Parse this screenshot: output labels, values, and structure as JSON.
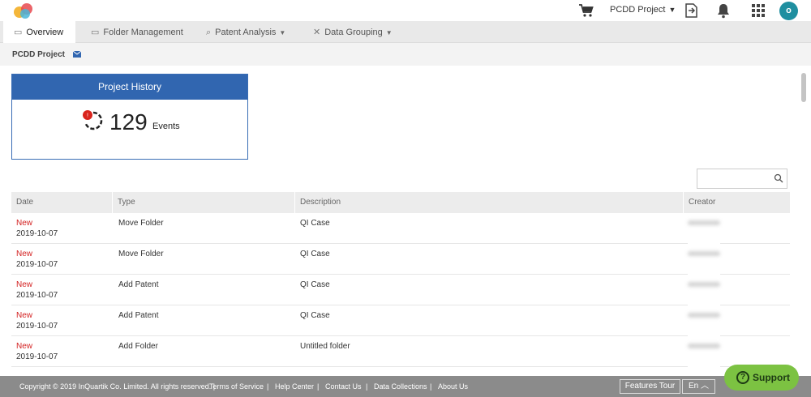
{
  "header": {
    "project_selector": "PCDD Project",
    "avatar_initial": "o"
  },
  "tabs": [
    {
      "label": "Overview",
      "icon": "overview-icon",
      "active": true
    },
    {
      "label": "Folder Management",
      "icon": "folder-icon"
    },
    {
      "label": "Patent Analysis",
      "icon": "analysis-icon",
      "dropdown": true
    },
    {
      "label": "Data Grouping",
      "icon": "grouping-icon",
      "dropdown": true
    }
  ],
  "breadcrumb": "PCDD Project",
  "history_card": {
    "title": "Project History",
    "count": "129",
    "count_label": "Events",
    "badge": "!"
  },
  "search": {
    "placeholder": ""
  },
  "table": {
    "headers": [
      "Date",
      "Type",
      "Description",
      "Creator"
    ],
    "rows": [
      {
        "status": "New",
        "date": "2019-10-07",
        "type": "Move Folder",
        "description": "QI Case"
      },
      {
        "status": "New",
        "date": "2019-10-07",
        "type": "Move Folder",
        "description": "QI Case"
      },
      {
        "status": "New",
        "date": "2019-10-07",
        "type": "Add Patent",
        "description": "QI Case"
      },
      {
        "status": "New",
        "date": "2019-10-07",
        "type": "Add Patent",
        "description": "QI Case"
      },
      {
        "status": "New",
        "date": "2019-10-07",
        "type": "Add Folder",
        "description": "Untitled folder"
      }
    ]
  },
  "footer": {
    "copyright": "Copyright © 2019 InQuartik Co. Limited. All rights reserved. |",
    "links": [
      "Terms of Service",
      "Help Center",
      "Contact Us",
      "Data Collections",
      "About Us"
    ],
    "features_tour": "Features Tour",
    "language": "En"
  },
  "support": {
    "label": "Support"
  },
  "colors": {
    "brand_blue": "#3166b0",
    "new_red": "#d32020",
    "support_green": "#7cc242",
    "footer_gray": "#8b8b8b"
  }
}
